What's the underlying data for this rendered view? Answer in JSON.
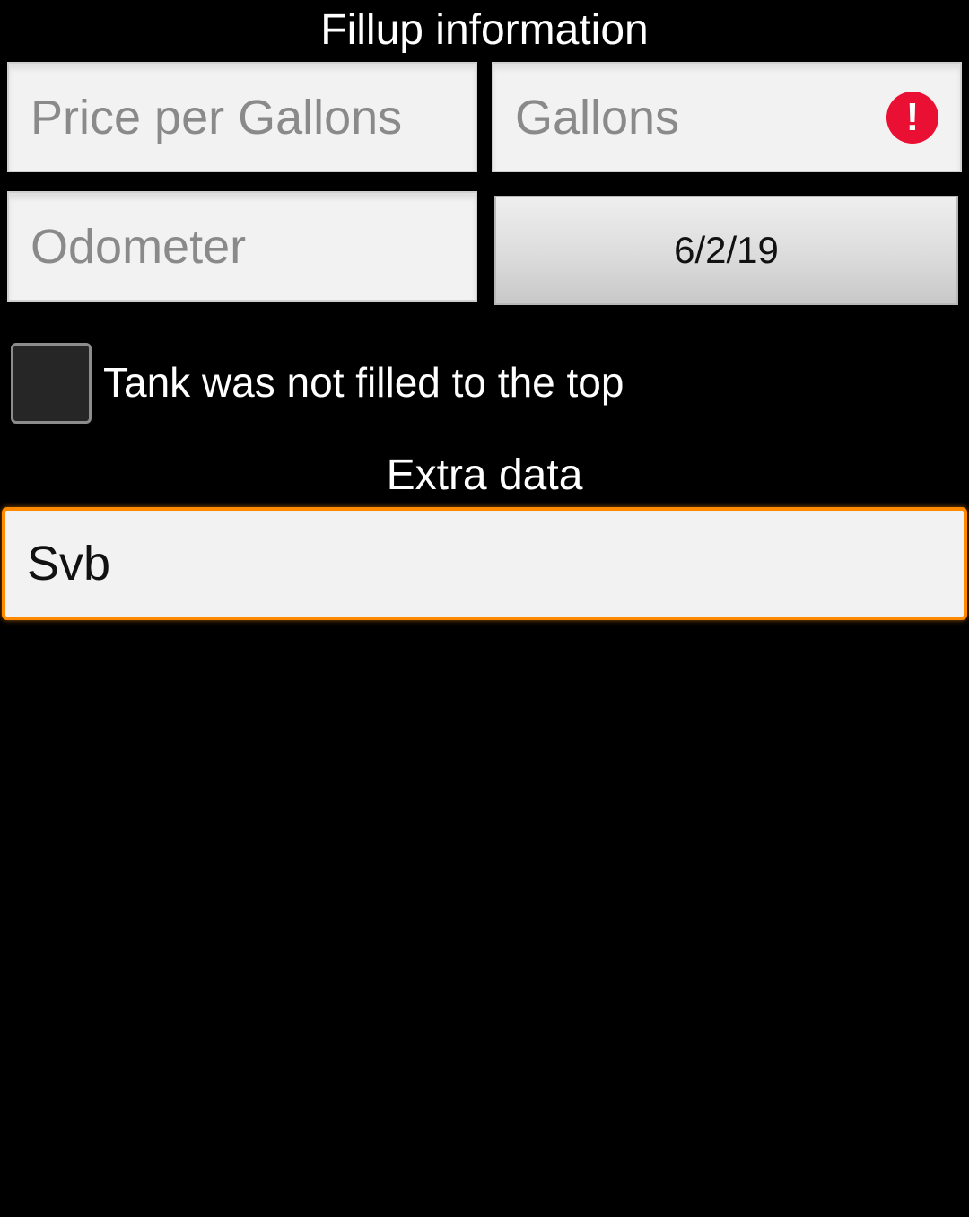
{
  "header": {
    "title": "Fillup information"
  },
  "fields": {
    "price_per_gallon": {
      "placeholder": "Price per Gallons",
      "value": ""
    },
    "gallons": {
      "placeholder": "Gallons",
      "value": "",
      "error_icon": "!"
    },
    "odometer": {
      "placeholder": "Odometer",
      "value": ""
    },
    "date": {
      "label": "6/2/19"
    }
  },
  "tank_checkbox": {
    "label": "Tank was not filled to the top",
    "checked": false
  },
  "extra": {
    "title": "Extra data",
    "value": "Svb"
  },
  "colors": {
    "background": "#000000",
    "focus_accent": "#ff8a00",
    "error": "#ea1033"
  }
}
